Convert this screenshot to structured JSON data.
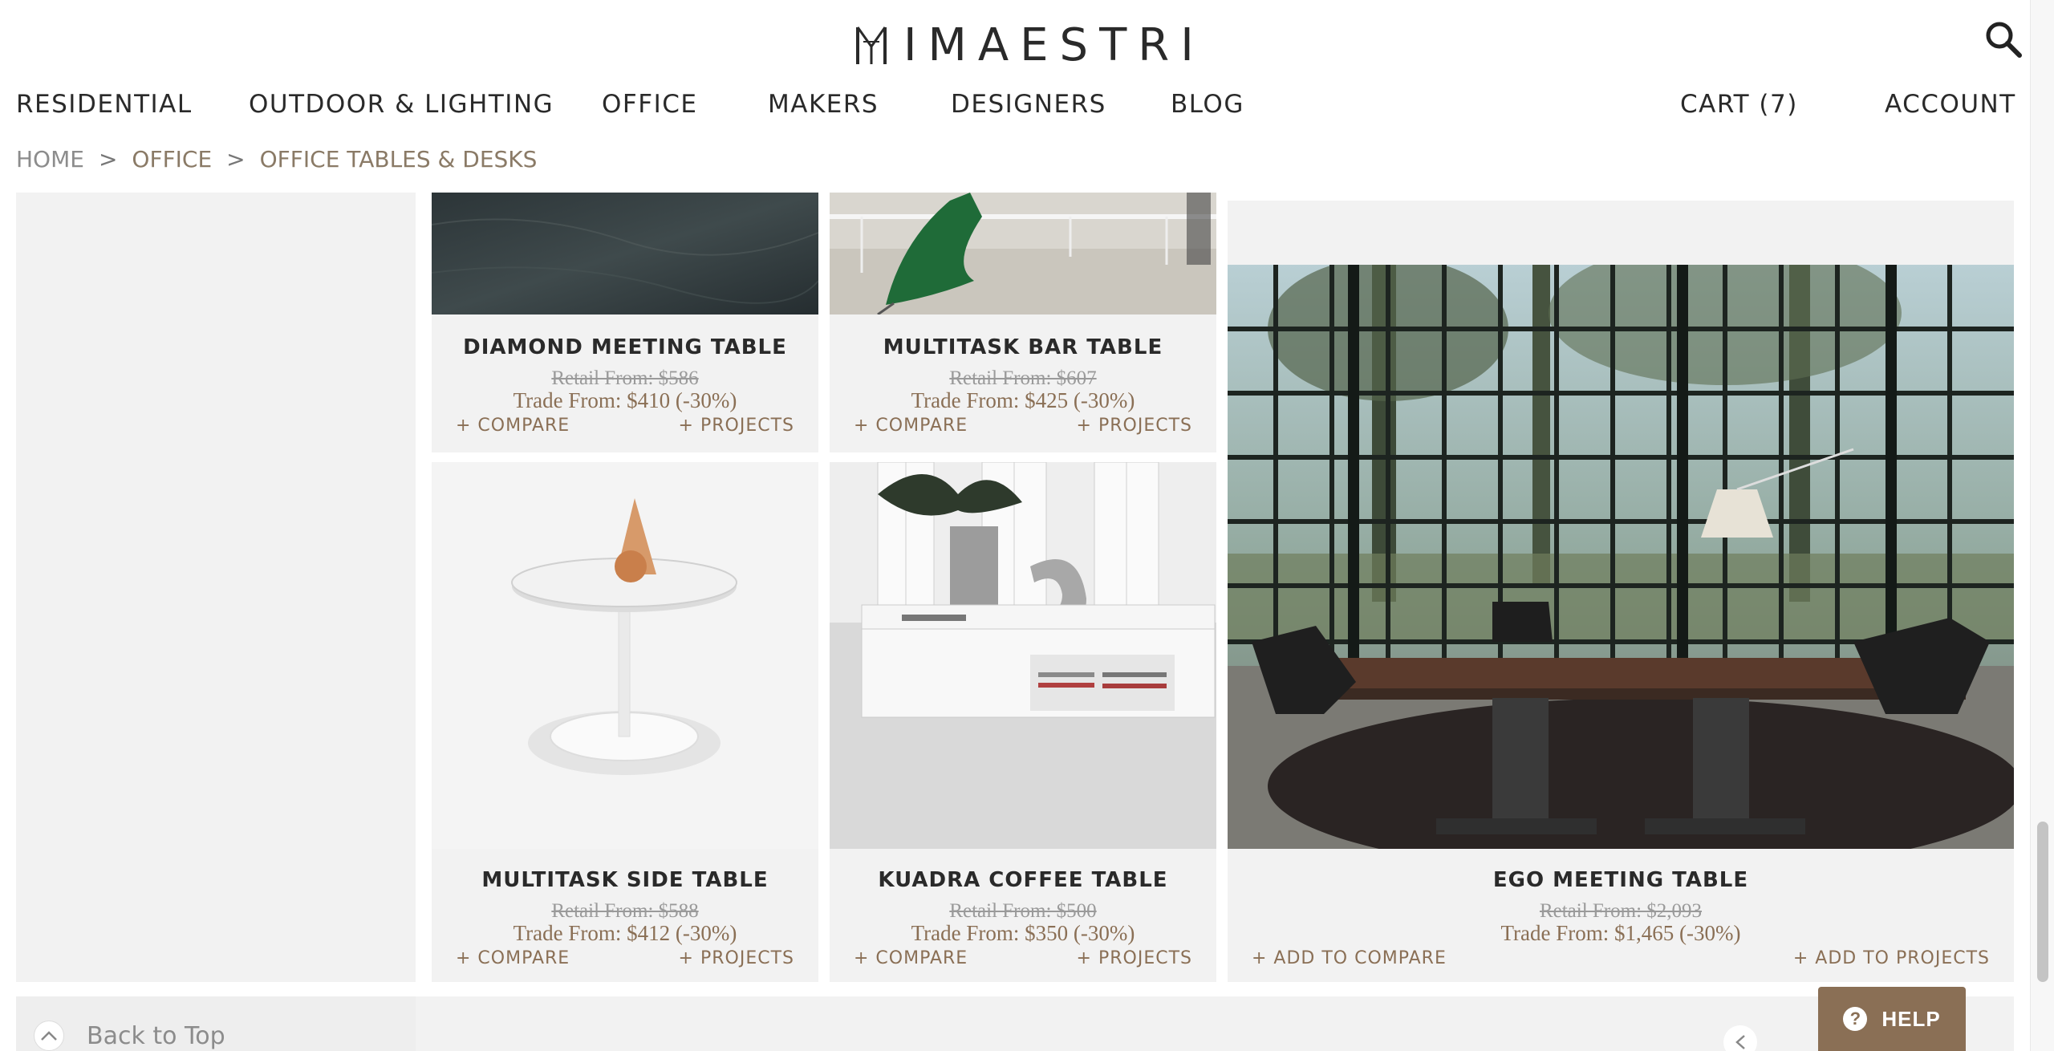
{
  "brand": {
    "name": "IMAESTRI",
    "accent": "#8a6f55"
  },
  "header": {
    "search_icon": "search-icon",
    "nav": [
      "RESIDENTIAL",
      "OUTDOOR & LIGHTING",
      "OFFICE",
      "MAKERS",
      "DESIGNERS",
      "BLOG"
    ],
    "cart": "CART (7)",
    "account": "ACCOUNT"
  },
  "breadcrumb": {
    "home": "HOME",
    "office": "OFFICE",
    "current": "OFFICE TABLES & DESKS",
    "separator": ">"
  },
  "products": [
    {
      "name": "DIAMOND MEETING TABLE",
      "retail": "Retail From: $586",
      "trade": "Trade From: $410 (-30%)",
      "compare": "+ COMPARE",
      "projects": "+ PROJECTS"
    },
    {
      "name": "MULTITASK BAR TABLE",
      "retail": "Retail From: $607",
      "trade": "Trade From: $425 (-30%)",
      "compare": "+ COMPARE",
      "projects": "+ PROJECTS"
    },
    {
      "name": "MULTITASK SIDE TABLE",
      "retail": "Retail From: $588",
      "trade": "Trade From: $412 (-30%)",
      "compare": "+ COMPARE",
      "projects": "+ PROJECTS"
    },
    {
      "name": "KUADRA COFFEE TABLE",
      "retail": "Retail From: $500",
      "trade": "Trade From: $350 (-30%)",
      "compare": "+ COMPARE",
      "projects": "+ PROJECTS"
    },
    {
      "name": "EGO MEETING TABLE",
      "retail": "Retail From: $2,093",
      "trade": "Trade From: $1,465 (-30%)",
      "compare": "+ ADD TO COMPARE",
      "projects": "+ ADD TO PROJECTS"
    }
  ],
  "footer": {
    "back_to_top": "Back to Top",
    "help": "HELP"
  }
}
